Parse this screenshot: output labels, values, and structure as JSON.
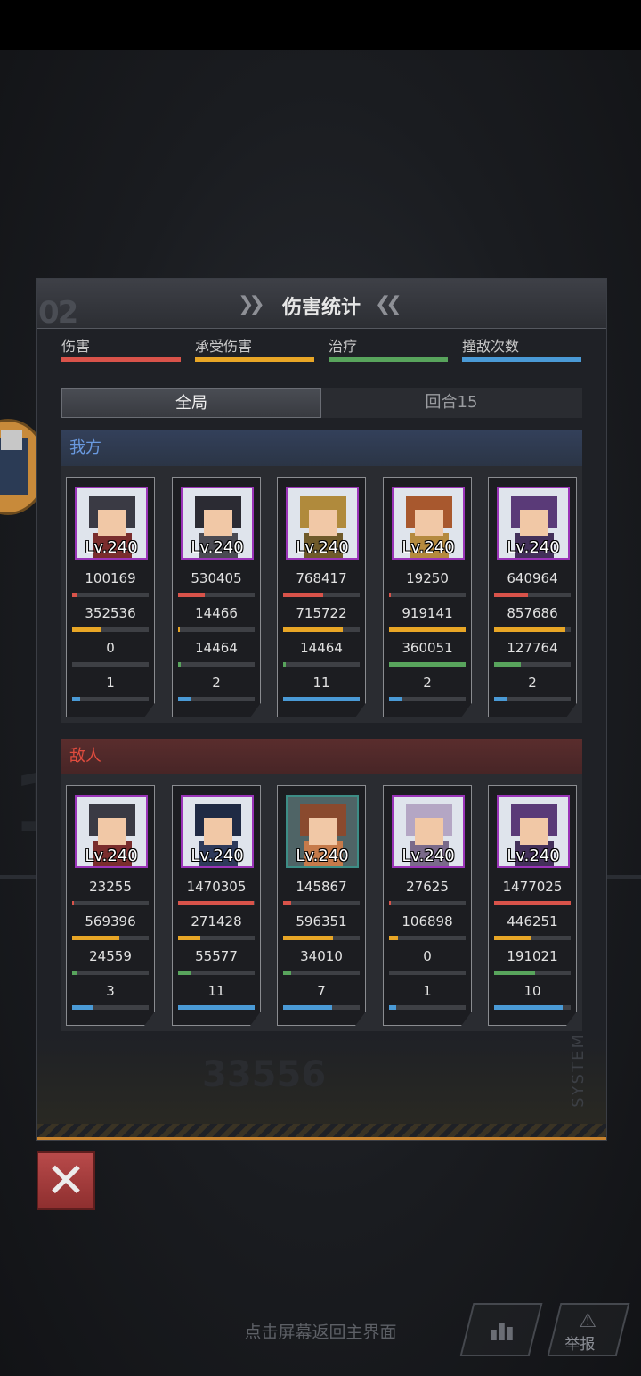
{
  "panel": {
    "title": "伤害统计",
    "deco_number": "02",
    "footer_number": "33556",
    "system_text": "SYSTEM"
  },
  "legend": [
    {
      "label": "伤害",
      "color": "#d9534a"
    },
    {
      "label": "承受伤害",
      "color": "#e8a626"
    },
    {
      "label": "治疗",
      "color": "#58a45c"
    },
    {
      "label": "撞敌次数",
      "color": "#4a9ad6"
    }
  ],
  "tabs": [
    {
      "label": "全局",
      "active": true
    },
    {
      "label": "回合15",
      "active": false
    }
  ],
  "sections": {
    "ours": "我方",
    "foes": "敌人"
  },
  "ours": [
    {
      "level": "Lv.240",
      "damage": "100169",
      "taken": "352536",
      "heal": "0",
      "hits": "1",
      "frac": [
        0.07,
        0.38,
        0.0,
        0.1
      ],
      "look": {
        "hair": "#3a3a44",
        "body": "#7a2d2d"
      }
    },
    {
      "level": "Lv.240",
      "damage": "530405",
      "taken": "14466",
      "heal": "14464",
      "hits": "2",
      "frac": [
        0.35,
        0.02,
        0.04,
        0.18
      ],
      "look": {
        "hair": "#2b2b33",
        "body": "#4a4a52"
      }
    },
    {
      "level": "Lv.240",
      "damage": "768417",
      "taken": "715722",
      "heal": "14464",
      "hits": "11",
      "frac": [
        0.52,
        0.78,
        0.04,
        1.0
      ],
      "look": {
        "hair": "#b08a3c",
        "body": "#6f5a2a"
      }
    },
    {
      "level": "Lv.240",
      "damage": "19250",
      "taken": "919141",
      "heal": "360051",
      "hits": "2",
      "frac": [
        0.02,
        1.0,
        1.0,
        0.18
      ],
      "look": {
        "hair": "#a8582e",
        "body": "#b58a3e"
      }
    },
    {
      "level": "Lv.240",
      "damage": "640964",
      "taken": "857686",
      "heal": "127764",
      "hits": "2",
      "frac": [
        0.44,
        0.93,
        0.35,
        0.18
      ],
      "look": {
        "hair": "#5a3a78",
        "body": "#43305a"
      }
    }
  ],
  "foes": [
    {
      "level": "Lv.240",
      "damage": "23255",
      "taken": "569396",
      "heal": "24559",
      "hits": "3",
      "frac": [
        0.02,
        0.62,
        0.07,
        0.28
      ],
      "look": {
        "hair": "#3a3a44",
        "body": "#7a2d2d"
      },
      "teal": false
    },
    {
      "level": "Lv.240",
      "damage": "1470305",
      "taken": "271428",
      "heal": "55577",
      "hits": "11",
      "frac": [
        0.99,
        0.29,
        0.16,
        1.0
      ],
      "look": {
        "hair": "#1f2a44",
        "body": "#2e3a5a"
      },
      "teal": false
    },
    {
      "level": "Lv.240",
      "damage": "145867",
      "taken": "596351",
      "heal": "34010",
      "hits": "7",
      "frac": [
        0.1,
        0.65,
        0.1,
        0.64
      ],
      "look": {
        "hair": "#8a4a2e",
        "body": "#c67a4a"
      },
      "teal": true
    },
    {
      "level": "Lv.240",
      "damage": "27625",
      "taken": "106898",
      "heal": "0",
      "hits": "1",
      "frac": [
        0.02,
        0.12,
        0.0,
        0.09
      ],
      "look": {
        "hair": "#b4a6c4",
        "body": "#7a6a8a"
      },
      "teal": false
    },
    {
      "level": "Lv.240",
      "damage": "1477025",
      "taken": "446251",
      "heal": "191021",
      "hits": "10",
      "frac": [
        1.0,
        0.48,
        0.54,
        0.9
      ],
      "look": {
        "hair": "#5a3a78",
        "body": "#43305a"
      },
      "teal": false
    }
  ],
  "close_icon": "close-x-icon",
  "hint": "点击屏幕返回主界面",
  "buttons": {
    "chart_icon": "bar-chart-icon",
    "report_label": "举报",
    "report_icon": "warning-triangle-icon"
  }
}
